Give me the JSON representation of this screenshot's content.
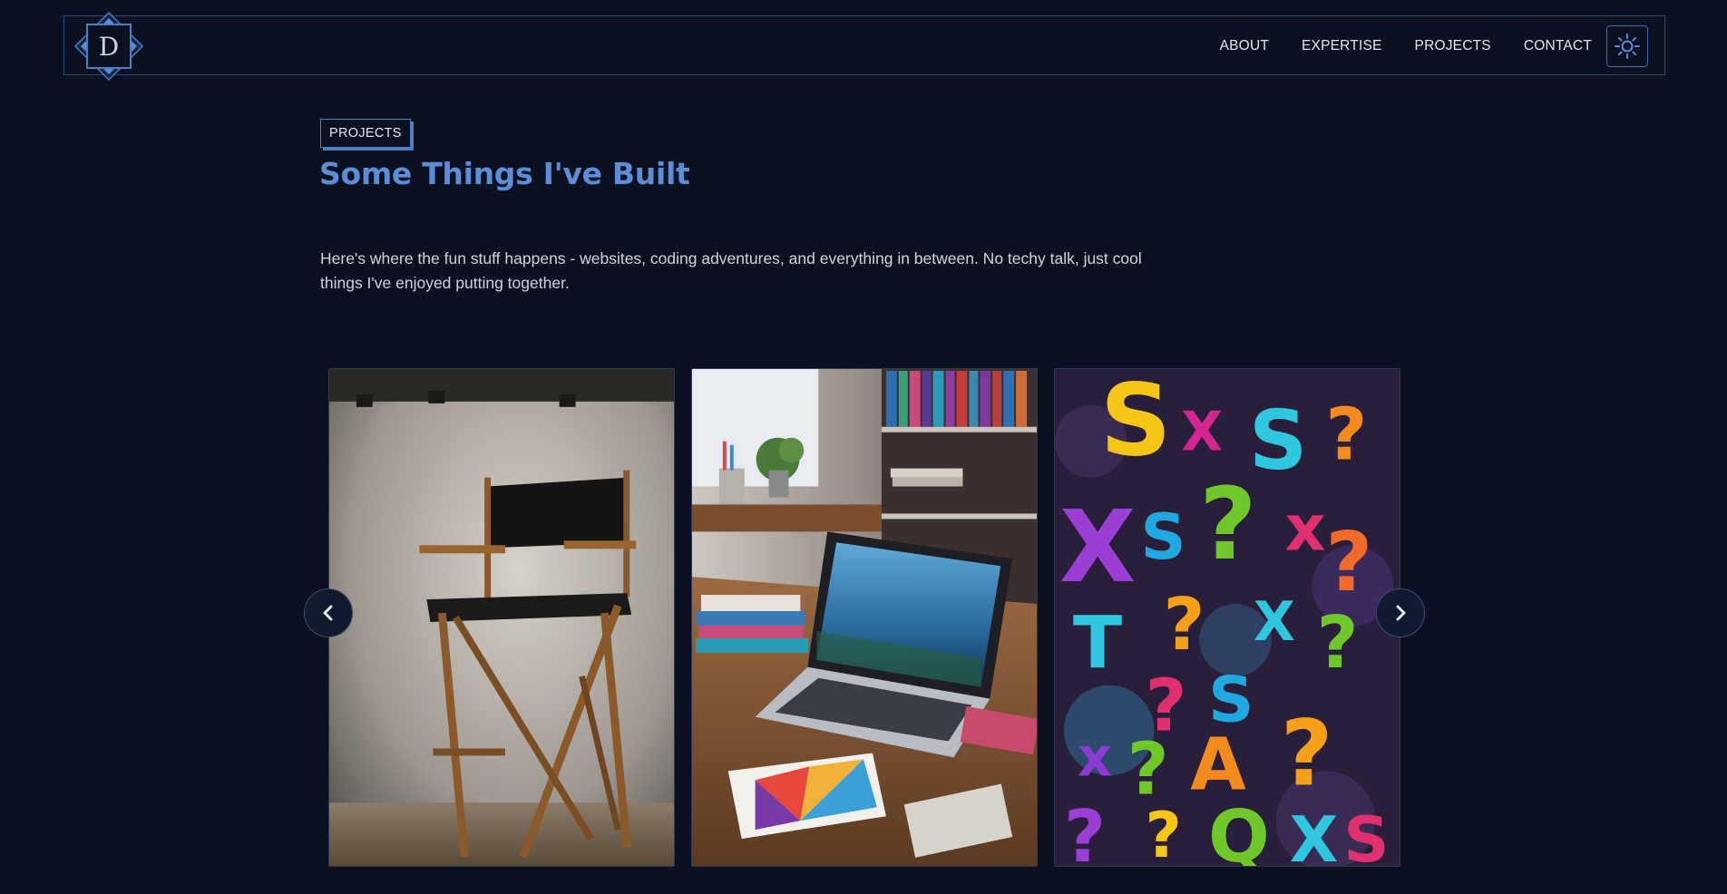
{
  "header": {
    "logo_letter": "D",
    "nav": {
      "about": "ABOUT",
      "expertise": "EXPERTISE",
      "projects": "PROJECTS",
      "contact": "CONTACT"
    },
    "theme_toggle_icon": "sun-icon"
  },
  "section": {
    "badge": "PROJECTS",
    "title": "Some Things I've Built",
    "description": "Here's where the fun stuff happens - websites, coding adventures, and everything in between. No techy talk, just cool things I've enjoyed putting together."
  },
  "carousel": {
    "prev_icon": "chevron-left-icon",
    "next_icon": "chevron-right-icon",
    "cards": [
      {
        "image": "directors-chair-photo"
      },
      {
        "image": "laptop-desk-photo"
      },
      {
        "image": "colorful-puzzle-letters-photo"
      }
    ]
  },
  "colors": {
    "background": "#0b1120",
    "accent": "#5b8ed6",
    "border": "#2b4a7a"
  }
}
